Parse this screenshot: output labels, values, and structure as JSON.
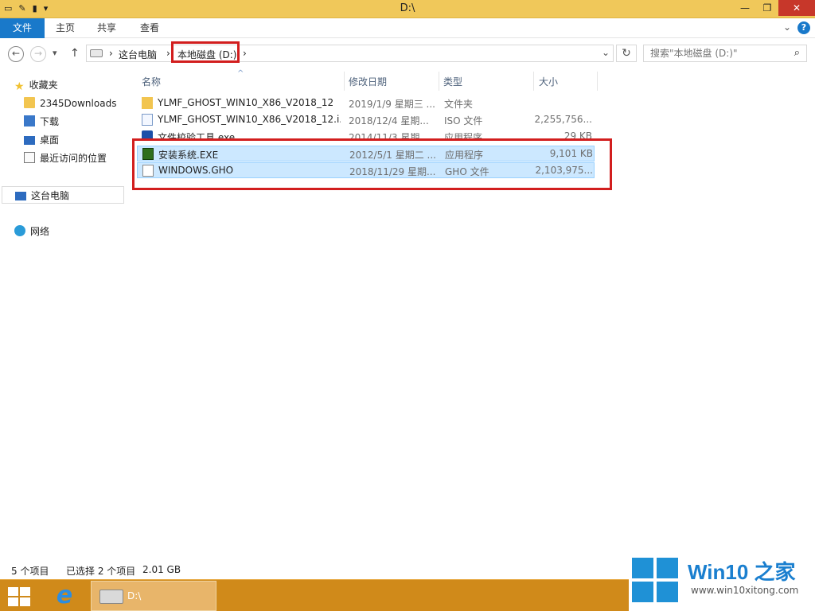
{
  "window": {
    "title": "D:\\"
  },
  "window_buttons": {
    "minimize": "—",
    "restore": "❐",
    "close": "✕"
  },
  "ribbon": {
    "tabs": [
      {
        "label": "文件"
      },
      {
        "label": "主页"
      },
      {
        "label": "共享"
      },
      {
        "label": "查看"
      }
    ],
    "expand": "⌄",
    "help": "?"
  },
  "nav": {
    "back": "←",
    "forward": "→",
    "recent": "▾",
    "up": "↑"
  },
  "address": {
    "crumbs": [
      "这台电脑",
      "本地磁盘 (D:)"
    ],
    "sep": "›",
    "dropdown": "⌄",
    "refresh": "↻"
  },
  "search": {
    "placeholder": "搜索\"本地磁盘 (D:)\"",
    "icon": "search-icon"
  },
  "sidebar": {
    "favorites": {
      "label": "收藏夹"
    },
    "favorite_items": [
      {
        "label": "2345Downloads"
      },
      {
        "label": "下载"
      },
      {
        "label": "桌面"
      },
      {
        "label": "最近访问的位置"
      }
    ],
    "this_pc": {
      "label": "这台电脑"
    },
    "network": {
      "label": "网络"
    }
  },
  "columns": {
    "name": "名称",
    "date": "修改日期",
    "type": "类型",
    "size": "大小",
    "sort_indicator": "^"
  },
  "files": [
    {
      "name": "YLMF_GHOST_WIN10_X86_V2018_12",
      "date": "2019/1/9 星期三 ...",
      "type": "文件夹",
      "size": "",
      "icon": "folder-icon"
    },
    {
      "name": "YLMF_GHOST_WIN10_X86_V2018_12.i...",
      "date": "2018/12/4 星期...",
      "type": "ISO 文件",
      "size": "2,255,756...",
      "icon": "iso-file-icon"
    },
    {
      "name": "文件校验工具.exe",
      "date": "2014/11/3 星期...",
      "type": "应用程序",
      "size": "29 KB",
      "icon": "exe-icon"
    },
    {
      "name": "安装系统.EXE",
      "date": "2012/5/1 星期二 ...",
      "type": "应用程序",
      "size": "9,101 KB",
      "icon": "setup-exe-icon"
    },
    {
      "name": "WINDOWS.GHO",
      "date": "2018/11/29 星期...",
      "type": "GHO 文件",
      "size": "2,103,975...",
      "icon": "gho-file-icon"
    }
  ],
  "status": {
    "count": "5 个项目",
    "selection": "已选择 2 个项目",
    "size": "2.01 GB"
  },
  "taskbar": {
    "window_label": "D:\\"
  },
  "watermark": {
    "title": "Win10 之家",
    "url": "www.win10xitong.com"
  },
  "colors": {
    "title_bar": "#f0c85a",
    "file_tab": "#1979ca",
    "selection": "#cce8ff",
    "highlight_box": "#d21e1e",
    "taskbar": "#d08a1a"
  }
}
